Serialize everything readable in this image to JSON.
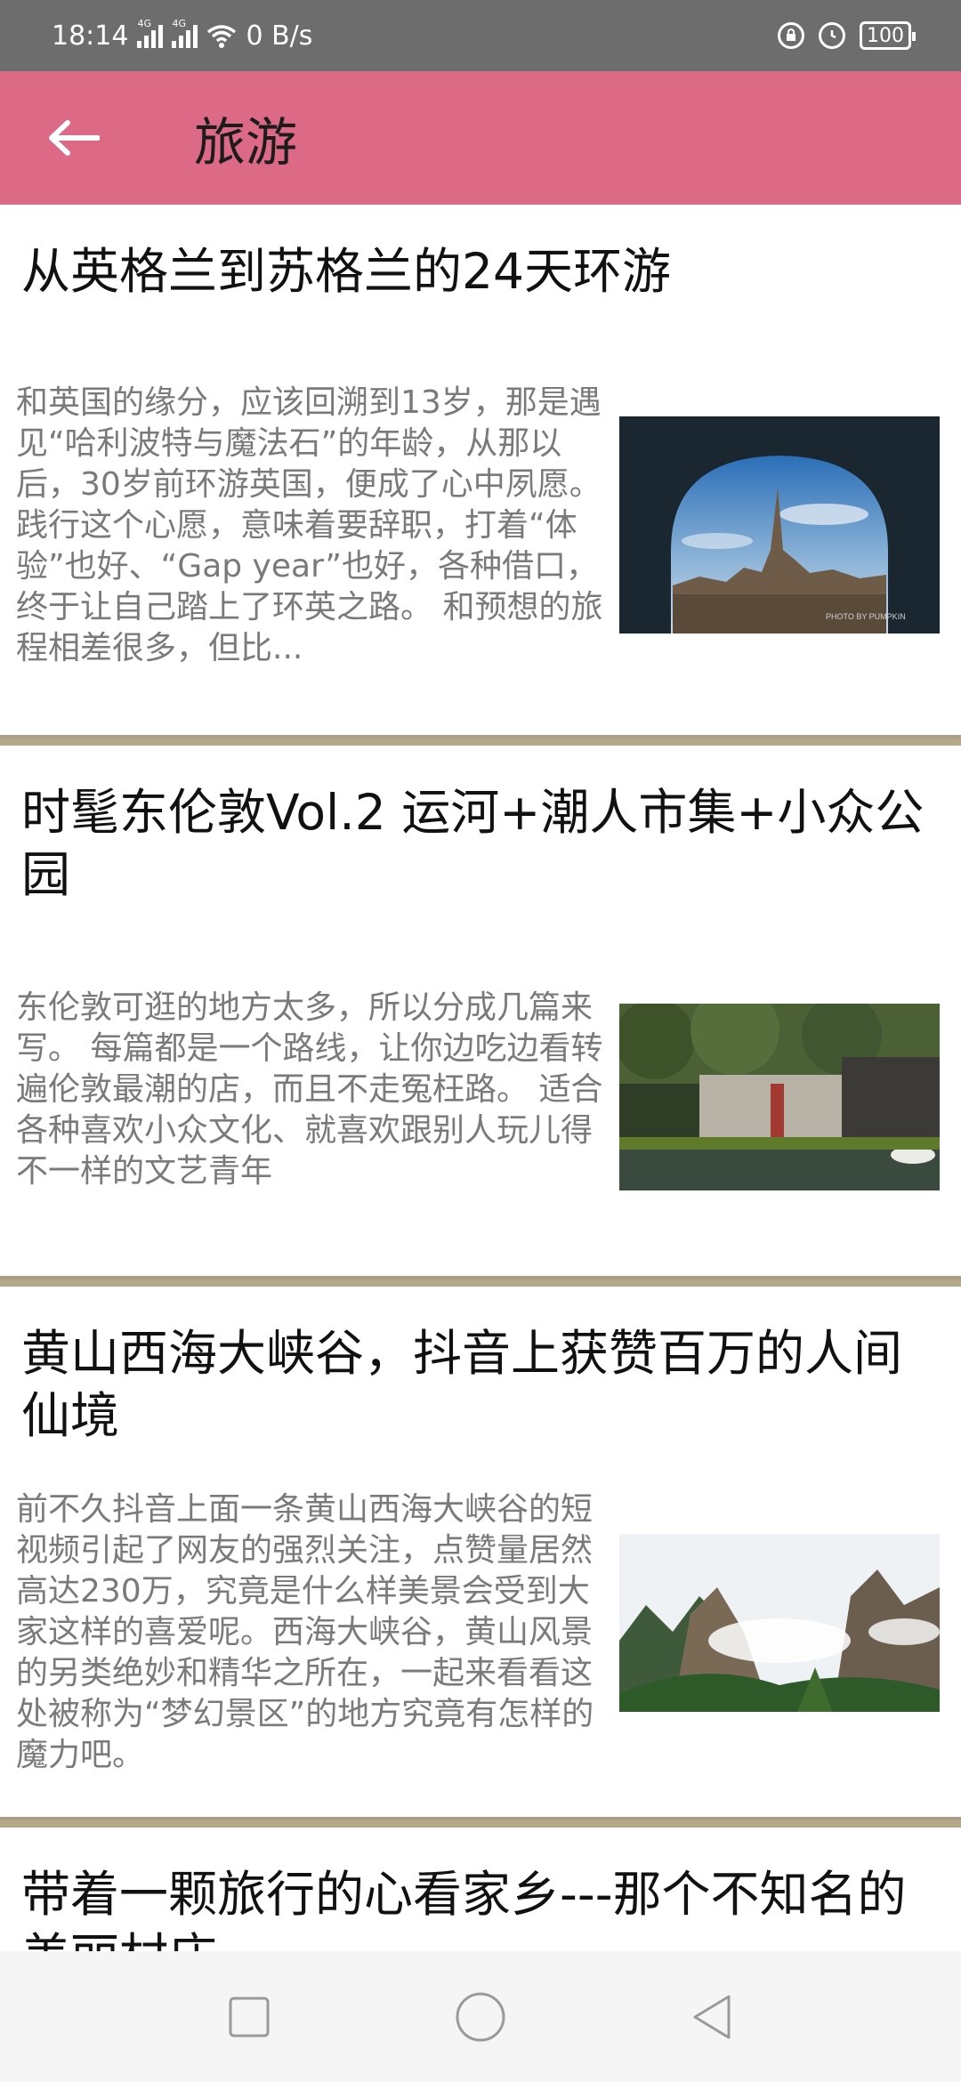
{
  "status_bar": {
    "time": "18:14",
    "network_1": "4G",
    "network_2": "4G",
    "speed": "0 B/s",
    "battery": "100"
  },
  "header": {
    "back_icon": "arrow-left-icon",
    "title": "旅游"
  },
  "articles": [
    {
      "title": "从英格兰到苏格兰的24天环游",
      "summary": "和英国的缘分，应该回溯到13岁，那是遇见“哈利波特与魔法石”的年龄，从那以后，30岁前环游英国，便成了心中夙愿。践行这个心愿，意味着要辞职，打着“体验”也好、“Gap year”也好，各种借口，终于让自己踏上了环英之路。 和预想的旅程相差很多，但比...",
      "image_watermark": "PHOTO BY PUMPKIN"
    },
    {
      "title": "时髦东伦敦Vol.2 运河+潮人市集+小众公园",
      "summary": "东伦敦可逛的地方太多，所以分成几篇来写。 每篇都是一个路线，让你边吃边看转遍伦敦最潮的店，而且不走冤枉路。 适合各种喜欢小众文化、就喜欢跟别人玩儿得不一样的文艺青年"
    },
    {
      "title": "黄山西海大峡谷，抖音上获赞百万的人间仙境",
      "summary": "前不久抖音上面一条黄山西海大峡谷的短视频引起了网友的强烈关注，点赞量居然高达230万，究竟是什么样美景会受到大家这样的喜爱呢。西海大峡谷，黄山风景的另类绝妙和精华之所在，一起来看看这处被称为“梦幻景区”的地方究竟有怎样的魔力吧。"
    },
    {
      "title": "带着一颗旅行的心看家乡---那个不知名的美丽村庄"
    }
  ],
  "nav_bar": {
    "recents_icon": "square-icon",
    "home_icon": "circle-icon",
    "back_icon": "triangle-back-icon"
  }
}
